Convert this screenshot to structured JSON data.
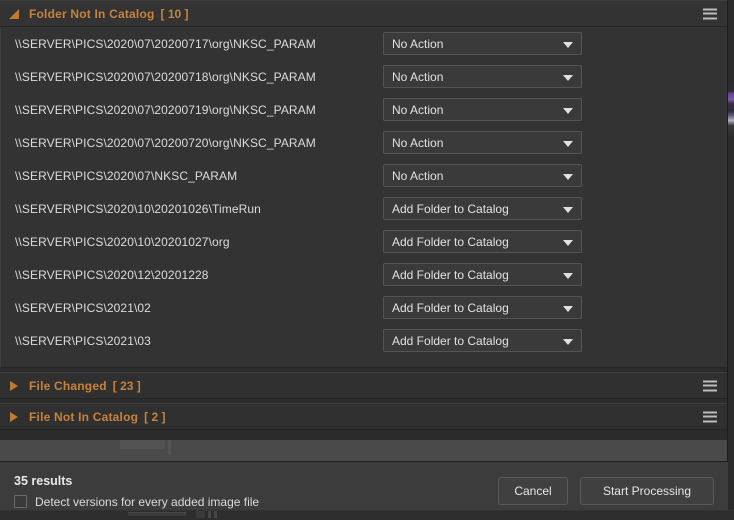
{
  "sections": [
    {
      "id": "folder-not-in-catalog",
      "title": "Folder Not In Catalog",
      "count": "[ 10 ]",
      "expanded": true,
      "menu_icon": "hamburger-icon",
      "disclosure_icon": "triangle-down-icon"
    },
    {
      "id": "file-changed",
      "title": "File Changed",
      "count": "[ 23 ]",
      "expanded": false,
      "menu_icon": "hamburger-icon",
      "disclosure_icon": "triangle-right-icon"
    },
    {
      "id": "file-not-in-catalog",
      "title": "File Not In Catalog",
      "count": "[ 2 ]",
      "expanded": false,
      "menu_icon": "hamburger-icon",
      "disclosure_icon": "triangle-right-icon"
    }
  ],
  "folder_rows": [
    {
      "path": "\\\\SERVER\\PICS\\2020\\07\\20200717\\org\\NKSC_PARAM",
      "action": "No Action"
    },
    {
      "path": "\\\\SERVER\\PICS\\2020\\07\\20200718\\org\\NKSC_PARAM",
      "action": "No Action"
    },
    {
      "path": "\\\\SERVER\\PICS\\2020\\07\\20200719\\org\\NKSC_PARAM",
      "action": "No Action"
    },
    {
      "path": "\\\\SERVER\\PICS\\2020\\07\\20200720\\org\\NKSC_PARAM",
      "action": "No Action"
    },
    {
      "path": "\\\\SERVER\\PICS\\2020\\07\\NKSC_PARAM",
      "action": "No Action"
    },
    {
      "path": "\\\\SERVER\\PICS\\2020\\10\\20201026\\TimeRun",
      "action": "Add Folder to Catalog"
    },
    {
      "path": "\\\\SERVER\\PICS\\2020\\10\\20201027\\org",
      "action": "Add Folder to Catalog"
    },
    {
      "path": "\\\\SERVER\\PICS\\2020\\12\\20201228",
      "action": "Add Folder to Catalog"
    },
    {
      "path": "\\\\SERVER\\PICS\\2021\\02",
      "action": "Add Folder to Catalog"
    },
    {
      "path": "\\\\SERVER\\PICS\\2021\\03",
      "action": "Add Folder to Catalog"
    }
  ],
  "action_options": [
    "No Action",
    "Add Folder to Catalog"
  ],
  "footer": {
    "results": "35 results",
    "detect_versions_label": "Detect versions for every added image file",
    "detect_versions_checked": false,
    "cancel_label": "Cancel",
    "start_label": "Start Processing"
  },
  "colors": {
    "accent_orange": "#c8823c",
    "panel_bg": "#333333",
    "window_bg": "#2b2b2b",
    "footer_bg": "#3c3c3c",
    "text_primary": "#dcdcdc"
  }
}
